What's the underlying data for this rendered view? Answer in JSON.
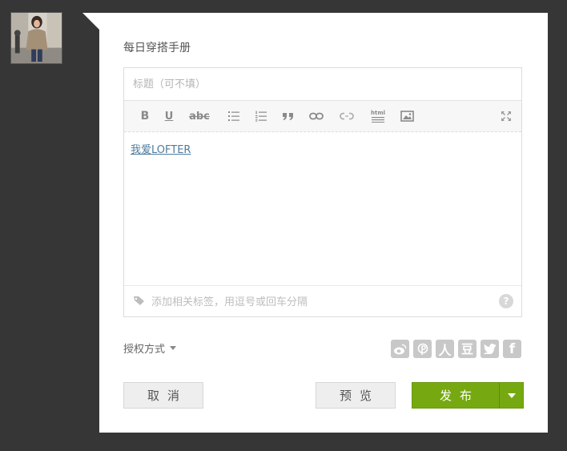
{
  "blog": {
    "name": "每日穿搭手册"
  },
  "editor": {
    "title_placeholder": "标题（可不填）",
    "body_link_text": "我爱LOFTER",
    "tags_placeholder": "添加相关标签，用逗号或回车分隔",
    "toolbar": {
      "bold": "B",
      "underline": "U",
      "strikethrough": "abc",
      "html_label": "html"
    }
  },
  "license": {
    "label": "授权方式"
  },
  "share_icons": [
    "weibo-icon",
    "pinterest-like-icon",
    "renren-icon",
    "douban-icon",
    "twitter-icon",
    "facebook-icon"
  ],
  "share_glyphs": {
    "renren": "人",
    "douban": "豆",
    "facebook": "f"
  },
  "buttons": {
    "cancel": "取消",
    "preview": "预览",
    "publish": "发布"
  },
  "colors": {
    "background": "#363636",
    "panel": "#ffffff",
    "publish": "#76a911",
    "link": "#4e7c9f"
  }
}
